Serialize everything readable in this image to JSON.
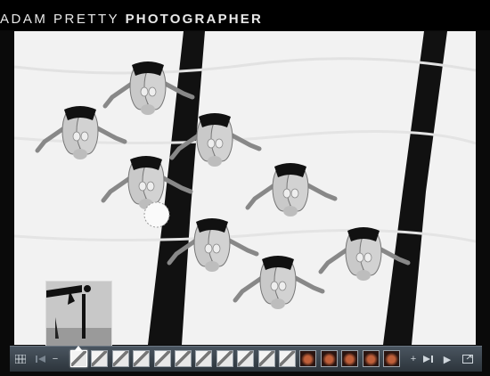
{
  "header": {
    "title_first": "ADAM PRETTY",
    "title_second": "PHOTOGRAPHER"
  },
  "photo": {
    "subject": "swimmers diving from above"
  },
  "toolbar": {
    "grid_icon": "grid-icon",
    "prev_icon": "skip-back-icon",
    "zoom_out_icon": "minus-icon",
    "zoom_in_icon": "plus-icon",
    "next_icon": "skip-forward-icon",
    "play_icon": "play-icon",
    "fullscreen_icon": "fullscreen-icon",
    "glyphs": {
      "minus": "−",
      "plus": "+",
      "play": "▶"
    }
  },
  "thumbnails": [
    {
      "tone": "light",
      "selected": true
    },
    {
      "tone": "light"
    },
    {
      "tone": "light"
    },
    {
      "tone": "light"
    },
    {
      "tone": "light"
    },
    {
      "tone": "light"
    },
    {
      "tone": "light"
    },
    {
      "tone": "light"
    },
    {
      "tone": "light"
    },
    {
      "tone": "light"
    },
    {
      "tone": "light"
    },
    {
      "tone": "dark"
    },
    {
      "tone": "dark"
    },
    {
      "tone": "dark"
    },
    {
      "tone": "dark"
    },
    {
      "tone": "dark"
    }
  ]
}
